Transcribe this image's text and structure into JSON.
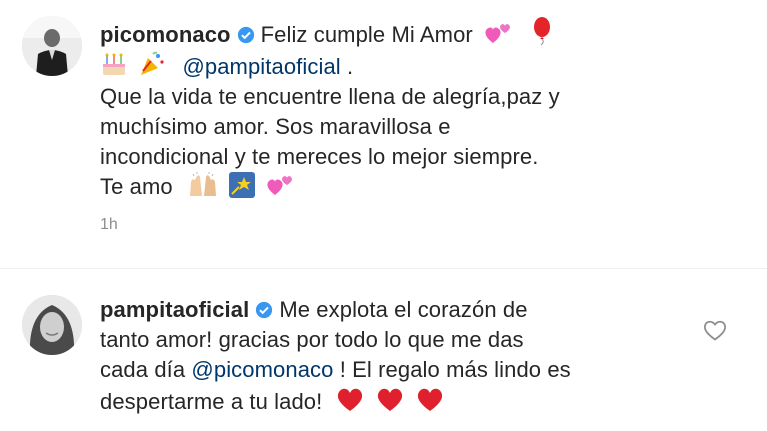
{
  "comments": [
    {
      "username": "picomonaco",
      "verified": true,
      "text_line1": "Feliz cumple Mi Amor",
      "mention": "@pampitaoficial",
      "mention_suffix": " .",
      "body_lines": [
        "Que la vida te encuentre llena de alegría,paz y",
        "muchísimo amor. Sos maravillosa e",
        "incondicional y te mereces lo mejor siempre.",
        "Te amo"
      ],
      "time": "1h"
    },
    {
      "username": "pampitaoficial",
      "verified": true,
      "line1": "Me explota el corazón de",
      "line2": "tanto amor! gracias por todo lo que me das",
      "line3_prefix": "cada día ",
      "mention": "@picomonaco",
      "line3_suffix": " ! El regalo más lindo es",
      "line4": "despertarme a tu lado!"
    }
  ],
  "colors": {
    "mention": "#00376b",
    "verified": "#3897f0",
    "timestamp": "#8e8e8e",
    "heart": "#e0202c"
  },
  "icons": [
    "verified-badge-icon",
    "heart-like-icon",
    "two-hearts-emoji",
    "balloon-emoji",
    "birthday-cake-emoji",
    "party-popper-emoji",
    "raising-hands-emoji",
    "shooting-star-emoji",
    "red-heart-emoji"
  ]
}
